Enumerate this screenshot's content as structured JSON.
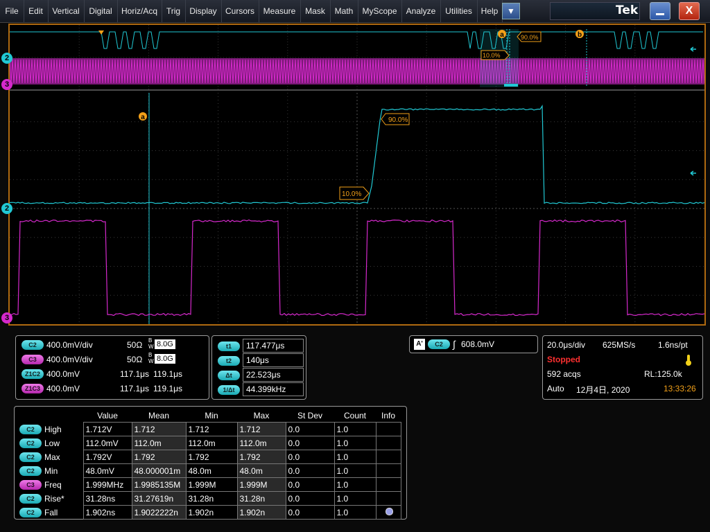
{
  "menu": [
    "File",
    "Edit",
    "Vertical",
    "Digital",
    "Horiz/Acq",
    "Trig",
    "Display",
    "Cursors",
    "Measure",
    "Mask",
    "Math",
    "MyScope",
    "Analyze",
    "Utilities",
    "Help"
  ],
  "menu_dropdown_glyph": "▼",
  "brand": "Tek",
  "window_buttons": {
    "close": "X"
  },
  "colors": {
    "ch2": "#21c9d4",
    "ch3": "#d629cc",
    "accent": "#f2a019",
    "frame": "#b06a10"
  },
  "display": {
    "channel_markers": {
      "ch2_overview": "2",
      "ch3_overview": "3",
      "ch2_main": "2",
      "ch3_main": "3"
    },
    "cursor_labels": {
      "a": "a",
      "b": "b",
      "a_main": "a"
    },
    "overview_pct_high": "90.0%",
    "overview_pct_low": "10.0%",
    "main_pct_high": "90.0%",
    "main_pct_low": "10.0%"
  },
  "vertical_panel": {
    "rows": [
      {
        "badge": "C2",
        "scale": "400.0mV/div",
        "term": "50Ω",
        "bw": "8.0G"
      },
      {
        "badge": "C3",
        "scale": "400.0mV/div",
        "term": "50Ω",
        "bw": "8.0G"
      },
      {
        "badge": "Z1C2",
        "scale": "400.0mV",
        "pos": "117.1μs",
        "pos2": "119.1μs"
      },
      {
        "badge": "Z1C3",
        "scale": "400.0mV",
        "pos": "117.1μs",
        "pos2": "119.1μs"
      }
    ],
    "bw_prefix_top": "B",
    "bw_prefix_bottom": "W"
  },
  "cursor_panel": {
    "rows": [
      {
        "badge": "t1",
        "value": "117.477μs"
      },
      {
        "badge": "t2",
        "value": "140μs"
      },
      {
        "badge": "Δt",
        "value": "22.523μs"
      },
      {
        "badge": "1/Δt",
        "value": "44.399kHz"
      }
    ]
  },
  "trigger_panel": {
    "mode_badge": "A'",
    "source": "C2",
    "slope_glyph": "∫",
    "level": "608.0mV"
  },
  "horizontal_panel": {
    "scale": "20.0μs/div",
    "sample_rate": "625MS/s",
    "resolution": "1.6ns/pt",
    "status": "Stopped",
    "acqs": "592 acqs",
    "record_length": "RL:125.0k",
    "trigger_mode": "Auto",
    "date": "12月4日, 2020",
    "time": "13:33:26"
  },
  "measurements": {
    "headers": [
      "Value",
      "Mean",
      "Min",
      "Max",
      "St Dev",
      "Count",
      "Info"
    ],
    "rows": [
      {
        "source": "C2",
        "name": "High",
        "value": "1.712V",
        "mean": "1.712",
        "min": "1.712",
        "max": "1.712",
        "stdev": "0.0",
        "count": "1.0"
      },
      {
        "source": "C2",
        "name": "Low",
        "value": "112.0mV",
        "mean": "112.0m",
        "min": "112.0m",
        "max": "112.0m",
        "stdev": "0.0",
        "count": "1.0"
      },
      {
        "source": "C2",
        "name": "Max",
        "value": "1.792V",
        "mean": "1.792",
        "min": "1.792",
        "max": "1.792",
        "stdev": "0.0",
        "count": "1.0"
      },
      {
        "source": "C2",
        "name": "Min",
        "value": "48.0mV",
        "mean": "48.000001m",
        "min": "48.0m",
        "max": "48.0m",
        "stdev": "0.0",
        "count": "1.0"
      },
      {
        "source": "C3",
        "name": "Freq",
        "value": "1.999MHz",
        "mean": "1.9985135M",
        "min": "1.999M",
        "max": "1.999M",
        "stdev": "0.0",
        "count": "1.0"
      },
      {
        "source": "C2",
        "name": "Rise*",
        "value": "31.28ns",
        "mean": "31.27619n",
        "min": "31.28n",
        "max": "31.28n",
        "stdev": "0.0",
        "count": "1.0"
      },
      {
        "source": "C2",
        "name": "Fall",
        "value": "1.902ns",
        "mean": "1.9022222n",
        "min": "1.902n",
        "max": "1.902n",
        "stdev": "0.0",
        "count": "1.0"
      }
    ]
  }
}
